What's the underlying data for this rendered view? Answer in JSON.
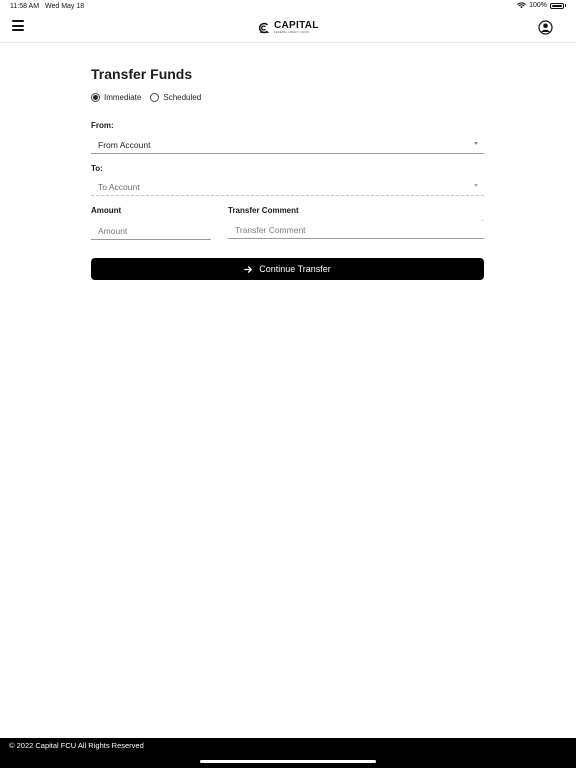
{
  "status_bar": {
    "time": "11:58 AM",
    "date": "Wed May 18",
    "battery": "100%",
    "icons": [
      "wifi-icon",
      "battery-icon"
    ]
  },
  "header": {
    "logo_name": "CAPITAL",
    "logo_subtitle": "FEDERAL CREDIT UNION",
    "icons": [
      "menu-icon",
      "logo-icon",
      "account-icon"
    ]
  },
  "form": {
    "title": "Transfer Funds",
    "transfer_type": {
      "options": [
        {
          "label": "Immediate",
          "checked": true
        },
        {
          "label": "Scheduled",
          "checked": false
        }
      ]
    },
    "from": {
      "label": "From:",
      "value": "From Account"
    },
    "to": {
      "label": "To:",
      "value": "To Account"
    },
    "amount": {
      "label": "Amount",
      "placeholder": "Amount",
      "value": ""
    },
    "comment": {
      "label": "Transfer Comment",
      "placeholder": "Transfer Comment",
      "value": ""
    },
    "continue_label": "Continue Transfer",
    "continue_icon": "arrow-right-icon"
  },
  "footer": {
    "copyright": "© 2022 Capital FCU All Rights Reserved"
  },
  "colors": {
    "primary": "#000000",
    "background": "#ffffff",
    "text": "#1b1b1b",
    "divider": "#9a9a9a"
  }
}
